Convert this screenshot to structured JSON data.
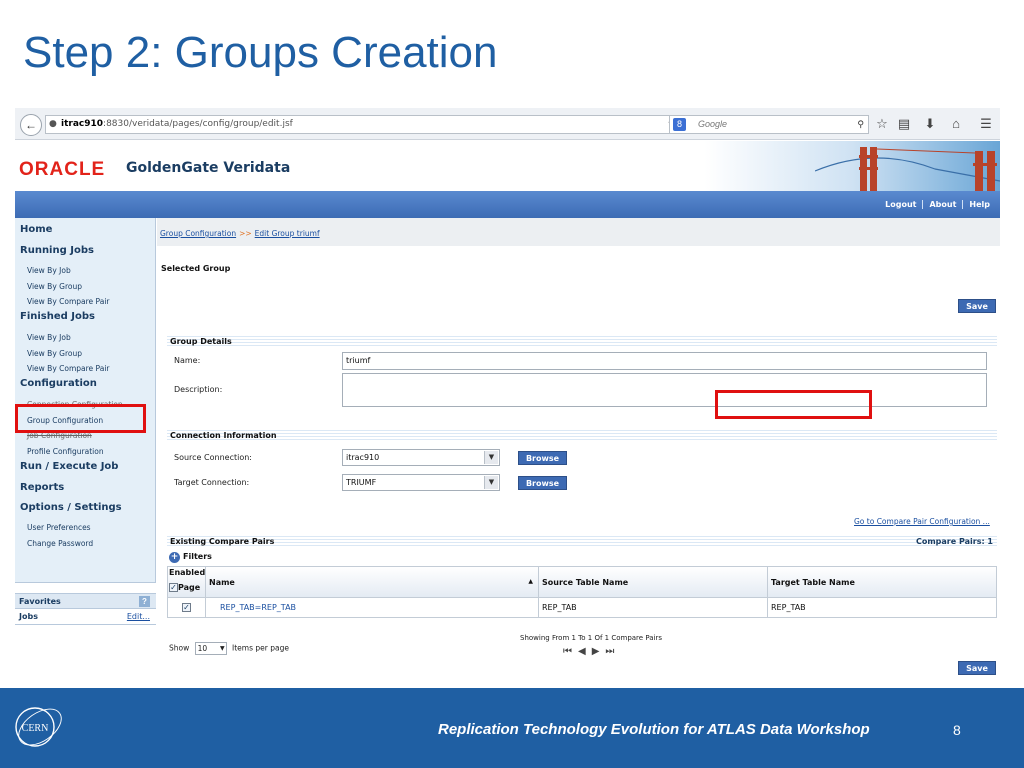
{
  "slide": {
    "title": "Step 2: Groups Creation",
    "footer_text": "Replication Technology Evolution for ATLAS Data Workshop",
    "page_number": "8",
    "footer_logo_text": "CERN"
  },
  "browser": {
    "url_host": "itrac910",
    "url_rest": ":8830/veridata/pages/config/group/edit.jsf",
    "search_engine_badge": "8",
    "search_placeholder": "Google"
  },
  "app": {
    "brand": "ORACLE",
    "product": "GoldenGate Veridata",
    "nav_links": [
      "Logout",
      "About",
      "Help"
    ]
  },
  "sidebar": {
    "home": "Home",
    "running_jobs": "Running Jobs",
    "running_items": [
      "View By Job",
      "View By Group",
      "View By Compare Pair"
    ],
    "finished_jobs": "Finished Jobs",
    "finished_items": [
      "View By Job",
      "View By Group",
      "View By Compare Pair"
    ],
    "configuration": "Configuration",
    "config_items": [
      "Connection Configuration",
      "Group Configuration",
      "Job Configuration",
      "Profile Configuration"
    ],
    "run_execute": "Run / Execute Job",
    "reports": "Reports",
    "options": "Options / Settings",
    "options_items": [
      "User Preferences",
      "Change Password"
    ],
    "favorites": "Favorites",
    "favorites_help": "?",
    "jobs": "Jobs",
    "edit": "Edit..."
  },
  "breadcrumb": {
    "root": "Group Configuration",
    "separator": ">>",
    "current": "Edit Group triumf"
  },
  "main": {
    "selected_group": "Selected Group",
    "save_label": "Save",
    "group_details": "Group Details",
    "name_label": "Name:",
    "name_value": "triumf",
    "description_label": "Description:",
    "description_value": "",
    "connection_info": "Connection Information",
    "source_label": "Source Connection:",
    "source_value": "itrac910",
    "target_label": "Target Connection:",
    "target_value": "TRIUMF",
    "browse_label": "Browse",
    "go_to_cp": "Go to Compare Pair Configuration ...",
    "existing_cp": "Existing Compare Pairs",
    "cp_count": "Compare Pairs: 1",
    "filters": "Filters"
  },
  "table": {
    "col_enabled": "Enabled",
    "col_page": "Page",
    "col_name": "Name",
    "col_source": "Source Table Name",
    "col_target": "Target Table Name",
    "rows": [
      {
        "name": "REP_TAB=REP_TAB",
        "source": "REP_TAB",
        "target": "REP_TAB"
      }
    ],
    "show_label": "Show",
    "show_value": "10",
    "items_per_page": "Items per page",
    "pager_info": "Showing From 1 To 1 Of 1 Compare Pairs"
  },
  "colors": {
    "title_blue": "#1f5fa3",
    "oracle_red": "#e2231a",
    "highlight_red": "#e01010",
    "button_blue": "#3d6ab3"
  }
}
